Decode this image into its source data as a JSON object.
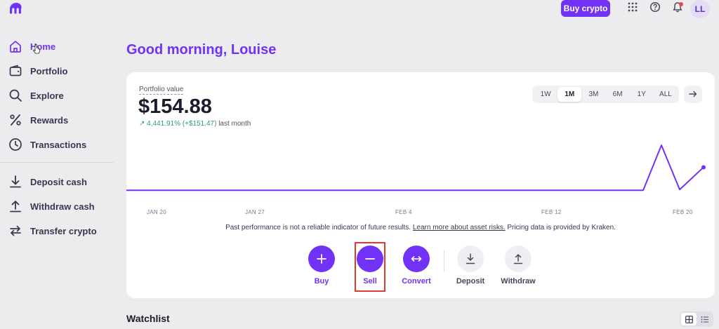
{
  "header": {
    "buy_crypto_label": "Buy crypto",
    "avatar_initials": "LL"
  },
  "sidebar": {
    "items": [
      {
        "label": "Home",
        "icon": "home-icon"
      },
      {
        "label": "Portfolio",
        "icon": "wallet-icon"
      },
      {
        "label": "Explore",
        "icon": "search-icon"
      },
      {
        "label": "Rewards",
        "icon": "percent-icon"
      },
      {
        "label": "Transactions",
        "icon": "clock-icon"
      }
    ],
    "secondary_items": [
      {
        "label": "Deposit cash",
        "icon": "download-icon"
      },
      {
        "label": "Withdraw cash",
        "icon": "upload-icon"
      },
      {
        "label": "Transfer crypto",
        "icon": "transfer-icon"
      }
    ]
  },
  "main": {
    "greeting": "Good morning, Louise",
    "portfolio": {
      "label": "Portfolio value",
      "value": "$154.88",
      "change": "4,441.91% (+$151.47)",
      "change_period": "last month"
    },
    "ranges": [
      "1W",
      "1M",
      "3M",
      "6M",
      "1Y",
      "ALL"
    ],
    "active_range": "1M",
    "x_ticks": [
      "JAN 20",
      "JAN 27",
      "FEB 4",
      "FEB 12",
      "FEB 20"
    ],
    "disclaimer": {
      "prefix": "Past performance is not a reliable indicator of future results.",
      "link": "Learn more about asset risks.",
      "suffix": "Pricing data is provided by Kraken."
    },
    "actions": [
      {
        "label": "Buy",
        "icon": "plus-icon",
        "style": "primary"
      },
      {
        "label": "Sell",
        "icon": "minus-icon",
        "style": "primary"
      },
      {
        "label": "Convert",
        "icon": "swap-icon",
        "style": "primary"
      },
      {
        "label": "Deposit",
        "icon": "download-icon",
        "style": "secondary"
      },
      {
        "label": "Withdraw",
        "icon": "upload-icon",
        "style": "secondary"
      }
    ],
    "watchlist_title": "Watchlist"
  },
  "colors": {
    "accent": "#7132f5",
    "positive": "#2f9e6a",
    "highlight": "#e03a2f"
  },
  "chart_data": {
    "type": "line",
    "x": [
      "Jan 20",
      "Jan 27",
      "Feb 4",
      "Feb 12",
      "Feb 17",
      "Feb 18",
      "Feb 19",
      "Feb 20"
    ],
    "values": [
      3.41,
      3.41,
      3.41,
      3.41,
      3.41,
      300,
      8,
      154.88
    ],
    "xlabel": "",
    "ylabel": "",
    "grid": false
  }
}
